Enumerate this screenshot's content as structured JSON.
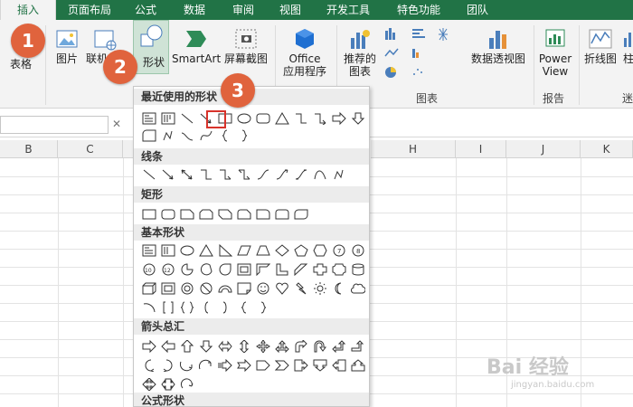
{
  "tabs": [
    {
      "label": "插入",
      "active": true
    },
    {
      "label": "页面布局"
    },
    {
      "label": "公式"
    },
    {
      "label": "数据"
    },
    {
      "label": "审阅"
    },
    {
      "label": "视图"
    },
    {
      "label": "开发工具"
    },
    {
      "label": "特色功能"
    },
    {
      "label": "团队"
    }
  ],
  "ribbon": {
    "table": "表格",
    "picture": "图片",
    "online": "联机",
    "shapes": "形状",
    "smartart": "SmartArt",
    "screenshot": "屏幕截图",
    "office_apps_1": "Office",
    "office_apps_2": "应用程序",
    "recommended_1": "推荐的",
    "recommended_2": "图表",
    "pivot_chart": "数据透视图",
    "power_view_1": "Power",
    "power_view_2": "View",
    "sparkline_line": "折线图",
    "sparkline_col": "柱",
    "group_chart": "图表",
    "group_report": "报告",
    "group_mini": "迷"
  },
  "columns": [
    "B",
    "C",
    "H",
    "I",
    "J",
    "K"
  ],
  "panel": {
    "recent": "最近使用的形状",
    "lines": "线条",
    "rect": "矩形",
    "basic": "基本形状",
    "arrows": "箭头总汇",
    "formula": "公式形状"
  },
  "badges": [
    "1",
    "2",
    "3"
  ],
  "watermark": {
    "brand": "Bai 经验",
    "url": "jingyan.baidu.com"
  },
  "colors": {
    "accent": "#217346",
    "badge": "#e0633d",
    "highlight": "#d8332b"
  }
}
